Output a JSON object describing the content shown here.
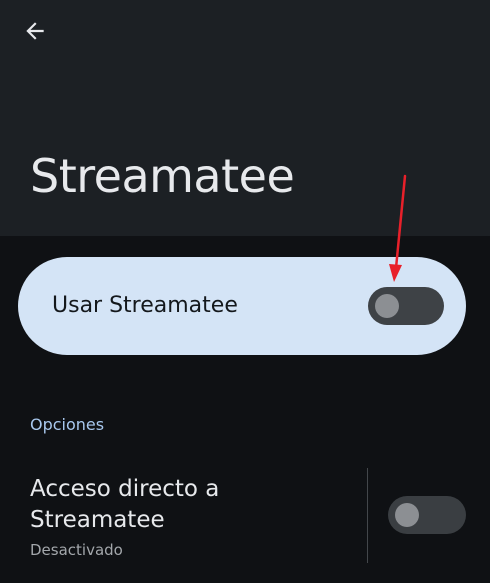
{
  "header": {
    "back_icon": "arrow-left-icon",
    "title": "Streamatee"
  },
  "main_switch": {
    "label": "Usar Streamatee",
    "checked": false
  },
  "options": {
    "header": "Opciones",
    "shortcut": {
      "title": "Acceso directo a Streamatee",
      "summary": "Desactivado",
      "checked": false
    }
  },
  "colors": {
    "background": "#0f1114",
    "top_bar": "#1c2024",
    "card": "#d4e4f6",
    "accent_text": "#a8c8ee",
    "annotation": "#e8202a"
  }
}
